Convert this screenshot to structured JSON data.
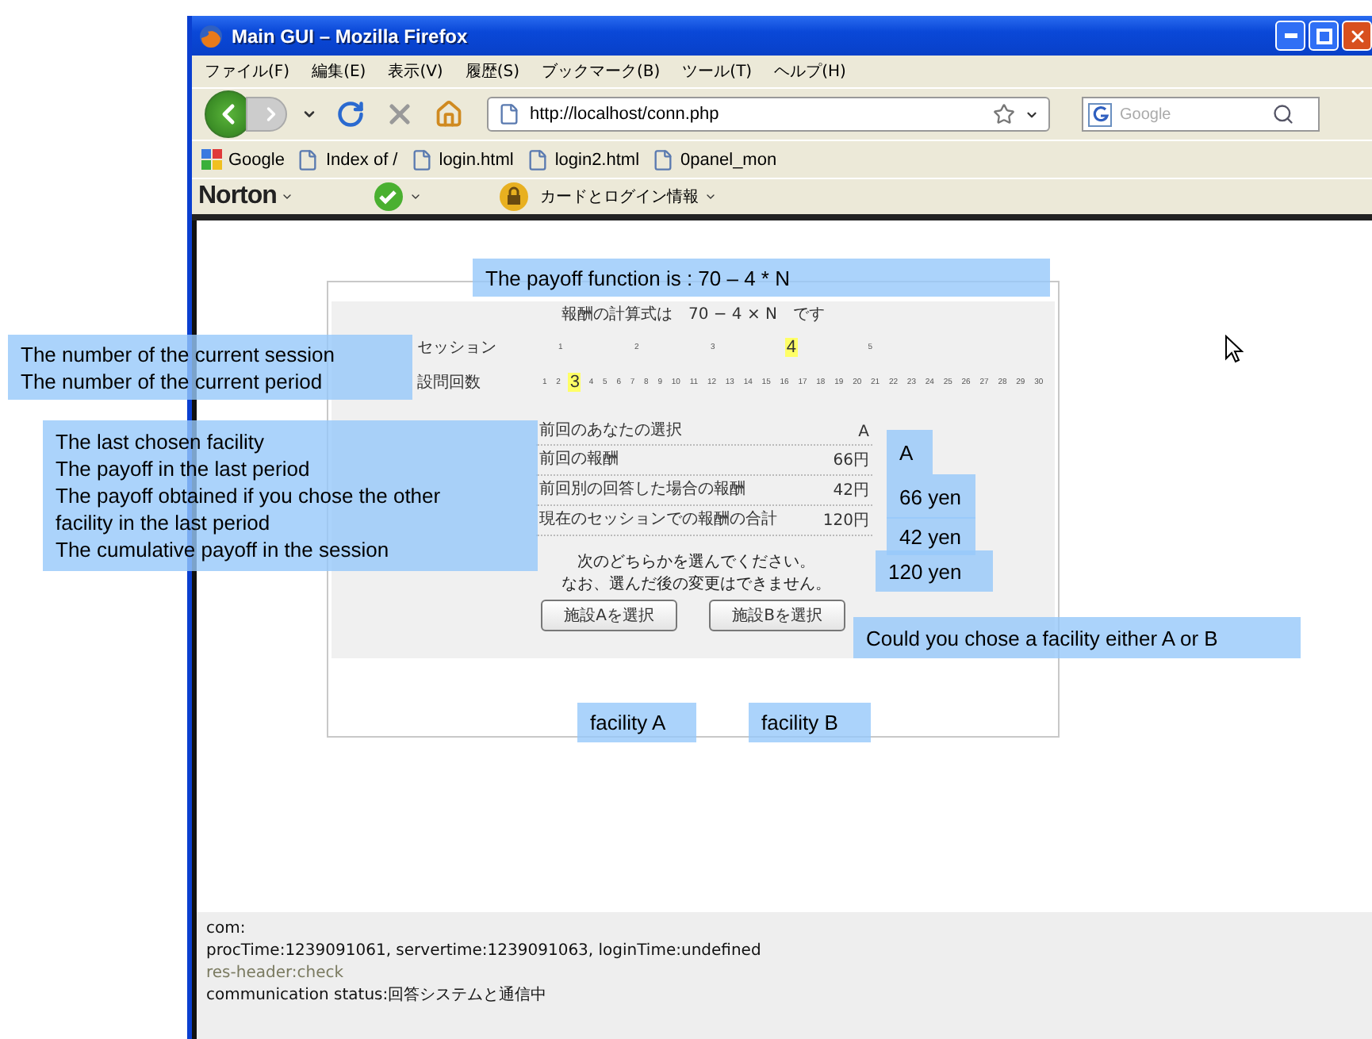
{
  "window": {
    "title": "Main GUI – Mozilla Firefox"
  },
  "menu": [
    "ファイル(F)",
    "編集(E)",
    "表示(V)",
    "履歴(S)",
    "ブックマーク(B)",
    "ツール(T)",
    "ヘルプ(H)"
  ],
  "address": {
    "value": "http://localhost/conn.php"
  },
  "search": {
    "placeholder": "Google"
  },
  "bookmarks": [
    "Google",
    "Index of /",
    "login.html",
    "login2.html",
    "0panel_mon"
  ],
  "norton": {
    "brand": "Norton",
    "identity": "カードとログイン情報"
  },
  "panel": {
    "formula": "報酬の計算式は　70 − 4 × N　です",
    "session": {
      "label": "セッション",
      "ticks": [
        {
          "label": "1",
          "selected": false
        },
        {
          "label": "2",
          "selected": false
        },
        {
          "label": "3",
          "selected": false
        },
        {
          "label": "4",
          "selected": true
        },
        {
          "label": "5",
          "selected": false
        }
      ]
    },
    "period": {
      "label": "設問回数",
      "ticks": [
        {
          "label": "1",
          "selected": false
        },
        {
          "label": "2",
          "selected": false
        },
        {
          "label": "3",
          "selected": true
        },
        {
          "label": "4",
          "selected": false
        },
        {
          "label": "5",
          "selected": false
        },
        {
          "label": "6",
          "selected": false
        },
        {
          "label": "7",
          "selected": false
        },
        {
          "label": "8",
          "selected": false
        },
        {
          "label": "9",
          "selected": false
        },
        {
          "label": "10",
          "selected": false
        },
        {
          "label": "11",
          "selected": false
        },
        {
          "label": "12",
          "selected": false
        },
        {
          "label": "13",
          "selected": false
        },
        {
          "label": "14",
          "selected": false
        },
        {
          "label": "15",
          "selected": false
        },
        {
          "label": "16",
          "selected": false
        },
        {
          "label": "17",
          "selected": false
        },
        {
          "label": "18",
          "selected": false
        },
        {
          "label": "19",
          "selected": false
        },
        {
          "label": "20",
          "selected": false
        },
        {
          "label": "21",
          "selected": false
        },
        {
          "label": "22",
          "selected": false
        },
        {
          "label": "23",
          "selected": false
        },
        {
          "label": "24",
          "selected": false
        },
        {
          "label": "25",
          "selected": false
        },
        {
          "label": "26",
          "selected": false
        },
        {
          "label": "27",
          "selected": false
        },
        {
          "label": "28",
          "selected": false
        },
        {
          "label": "29",
          "selected": false
        },
        {
          "label": "30",
          "selected": false
        }
      ]
    },
    "results": [
      {
        "label": "前回のあなたの選択",
        "value": "A"
      },
      {
        "label": "前回の報酬",
        "value": "66円"
      },
      {
        "label": "前回別の回答した場合の報酬",
        "value": "42円"
      },
      {
        "label": "現在のセッションでの報酬の合計",
        "value": "120円"
      }
    ],
    "prompt": [
      "次のどちらかを選んでください。",
      "なお、選んだ後の変更はできません。"
    ],
    "buttons": [
      "施設Aを選択",
      "施設Bを選択"
    ]
  },
  "debug": [
    {
      "text": "com:",
      "kind": "normal"
    },
    {
      "text": "procTime:1239091061, servertime:1239091063, loginTime:undefined",
      "kind": "normal"
    },
    {
      "text": "res-header:check",
      "kind": "muted"
    },
    {
      "text": "communication status:回答システムと通信中",
      "kind": "normal"
    }
  ],
  "annotations": [
    {
      "lines": [
        "The payoff function is : 70 – 4 * N"
      ]
    },
    {
      "lines": [
        "The number of the current session",
        "The number of the current period"
      ]
    },
    {
      "lines": [
        "The last chosen facility",
        "The payoff in the last period",
        "The payoff obtained if you chose the other",
        "facility in the last period",
        "The cumulative payoff in the session"
      ]
    },
    {
      "lines": [
        "A"
      ]
    },
    {
      "lines": [
        "66 yen"
      ]
    },
    {
      "lines": [
        "42 yen"
      ]
    },
    {
      "lines": [
        "120 yen"
      ]
    },
    {
      "lines": [
        "Could you chose a facility either A or B"
      ]
    },
    {
      "lines": [
        "facility A"
      ]
    },
    {
      "lines": [
        "facility B"
      ]
    }
  ]
}
